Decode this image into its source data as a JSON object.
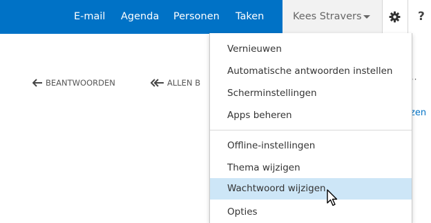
{
  "nav": {
    "items": [
      {
        "label": "E-mail"
      },
      {
        "label": "Agenda"
      },
      {
        "label": "Personen"
      },
      {
        "label": "Taken"
      }
    ],
    "user_name": "Kees Stravers",
    "help_label": "?"
  },
  "toolbar": {
    "reply_label": "BEANTWOORDEN",
    "reply_all_label": "ALLEN B",
    "more_label": "···",
    "side_link_label": "zen"
  },
  "settings_menu": {
    "group1": [
      {
        "label": "Vernieuwen"
      },
      {
        "label": "Automatische antwoorden instellen"
      },
      {
        "label": "Scherminstellingen"
      },
      {
        "label": "Apps beheren"
      }
    ],
    "group2": [
      {
        "label": "Offline-instellingen"
      },
      {
        "label": "Thema wijzigen"
      },
      {
        "label": "Wachtwoord wijzigen",
        "highlighted": true
      },
      {
        "label": "Opties"
      }
    ]
  },
  "colors": {
    "brand_blue": "#0072c6",
    "highlight": "#cde6f7"
  },
  "icons": [
    "arrow-left-icon",
    "double-arrow-left-icon",
    "gear-icon",
    "chevron-down-icon",
    "mouse-pointer-icon"
  ]
}
